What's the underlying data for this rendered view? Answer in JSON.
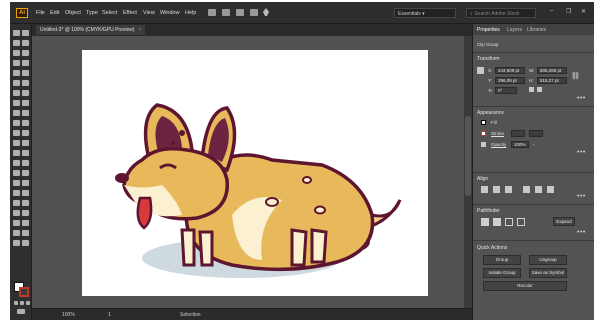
{
  "app": {
    "logo_text": "Ai"
  },
  "menubar": {
    "items": [
      "File",
      "Edit",
      "Object",
      "Type",
      "Select",
      "Effect",
      "View",
      "Window",
      "Help"
    ],
    "workspace": "Essentials ▾",
    "search_placeholder": "Search Adobe Stock",
    "window_controls": {
      "minimize": "–",
      "restore": "❐",
      "close": "✕"
    }
  },
  "document": {
    "tab_title": "Untitled-3* @ 100% (CMYK/GPU Preview)",
    "tab_close": "×"
  },
  "status": {
    "zoom": "100%",
    "page": "1",
    "tool": "Selection"
  },
  "panel": {
    "tabs": [
      "Properties",
      "Layers",
      "Libraries"
    ],
    "selection_type": "Clip Group",
    "transform": {
      "title": "Transform",
      "x_label": "X:",
      "x": "444,609 pt",
      "y_label": "Y:",
      "y": "296,09 pt",
      "w_label": "W:",
      "w": "505,268 pt",
      "h_label": "H:",
      "h": "515,27 pt",
      "angle": "0°"
    },
    "appearance": {
      "title": "Appearance",
      "fill_label": "Fill",
      "stroke_label": "Stroke",
      "opacity_label": "Opacity",
      "opacity": "100%"
    },
    "align": {
      "title": "Align"
    },
    "pathfinder": {
      "title": "Pathfinder",
      "expand_label": "Expand"
    },
    "quick_actions": {
      "title": "Quick Actions",
      "buttons": [
        "Group",
        "Ungroup",
        "Isolate Group",
        "Save as Symbol",
        "Recolor"
      ]
    }
  },
  "colors": {
    "fur_main": "#e8b95a",
    "fur_light": "#f4d58e",
    "fur_cream": "#fbf0d0",
    "outline": "#5e1530",
    "tongue": "#d63a3a",
    "ear_inner": "#6b2440",
    "shadow": "#cfd9e0"
  }
}
